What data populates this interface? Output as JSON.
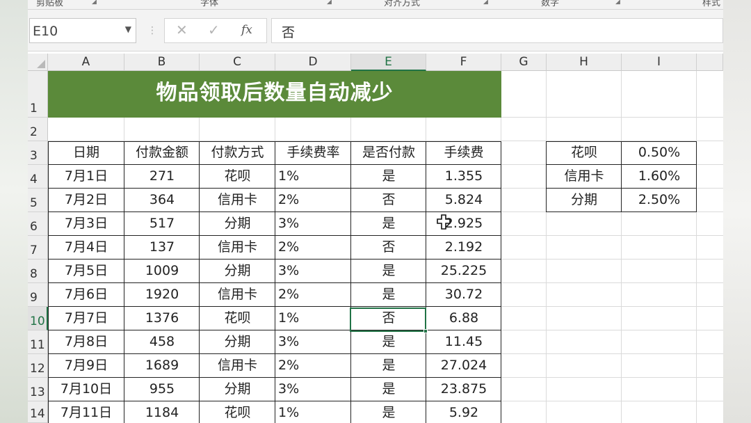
{
  "ribbon": {
    "groups": [
      "剪贴板",
      "字体",
      "对齐方式",
      "数字",
      "样式"
    ]
  },
  "formula_bar": {
    "name_box": "E10",
    "cancel_glyph": "✕",
    "enter_glyph": "✓",
    "fx_label": "fx",
    "value": "否"
  },
  "columns": [
    "A",
    "B",
    "C",
    "D",
    "E",
    "F",
    "G",
    "H",
    "I"
  ],
  "rows": [
    "1",
    "2",
    "3",
    "4",
    "5",
    "6",
    "7",
    "8",
    "9",
    "10",
    "11",
    "12",
    "13",
    "14"
  ],
  "title": "物品领取后数量自动减少",
  "table": {
    "headers": [
      "日期",
      "付款金额",
      "付款方式",
      "手续费率",
      "是否付款",
      "手续费"
    ],
    "rows": [
      [
        "7月1日",
        "271",
        "花呗",
        "1%",
        "是",
        "1.355"
      ],
      [
        "7月2日",
        "364",
        "信用卡",
        "2%",
        "否",
        "5.824"
      ],
      [
        "7月3日",
        "517",
        "分期",
        "3%",
        "是",
        "2.925"
      ],
      [
        "7月4日",
        "137",
        "信用卡",
        "2%",
        "否",
        "2.192"
      ],
      [
        "7月5日",
        "1009",
        "分期",
        "3%",
        "是",
        "25.225"
      ],
      [
        "7月6日",
        "1920",
        "信用卡",
        "2%",
        "是",
        "30.72"
      ],
      [
        "7月7日",
        "1376",
        "花呗",
        "1%",
        "否",
        "6.88"
      ],
      [
        "7月8日",
        "458",
        "分期",
        "3%",
        "是",
        "11.45"
      ],
      [
        "7月9日",
        "1689",
        "信用卡",
        "2%",
        "是",
        "27.024"
      ],
      [
        "7月10日",
        "955",
        "分期",
        "3%",
        "是",
        "23.875"
      ],
      [
        "7月11日",
        "1184",
        "花呗",
        "1%",
        "是",
        "5.92"
      ]
    ]
  },
  "rate_table": [
    [
      "花呗",
      "0.50%"
    ],
    [
      "信用卡",
      "1.60%"
    ],
    [
      "分期",
      "2.50%"
    ]
  ],
  "selection": {
    "cell": "E10",
    "column": "E",
    "row": "10"
  },
  "colors": {
    "title_fill": "#5b8a3a",
    "selection": "#217346"
  }
}
